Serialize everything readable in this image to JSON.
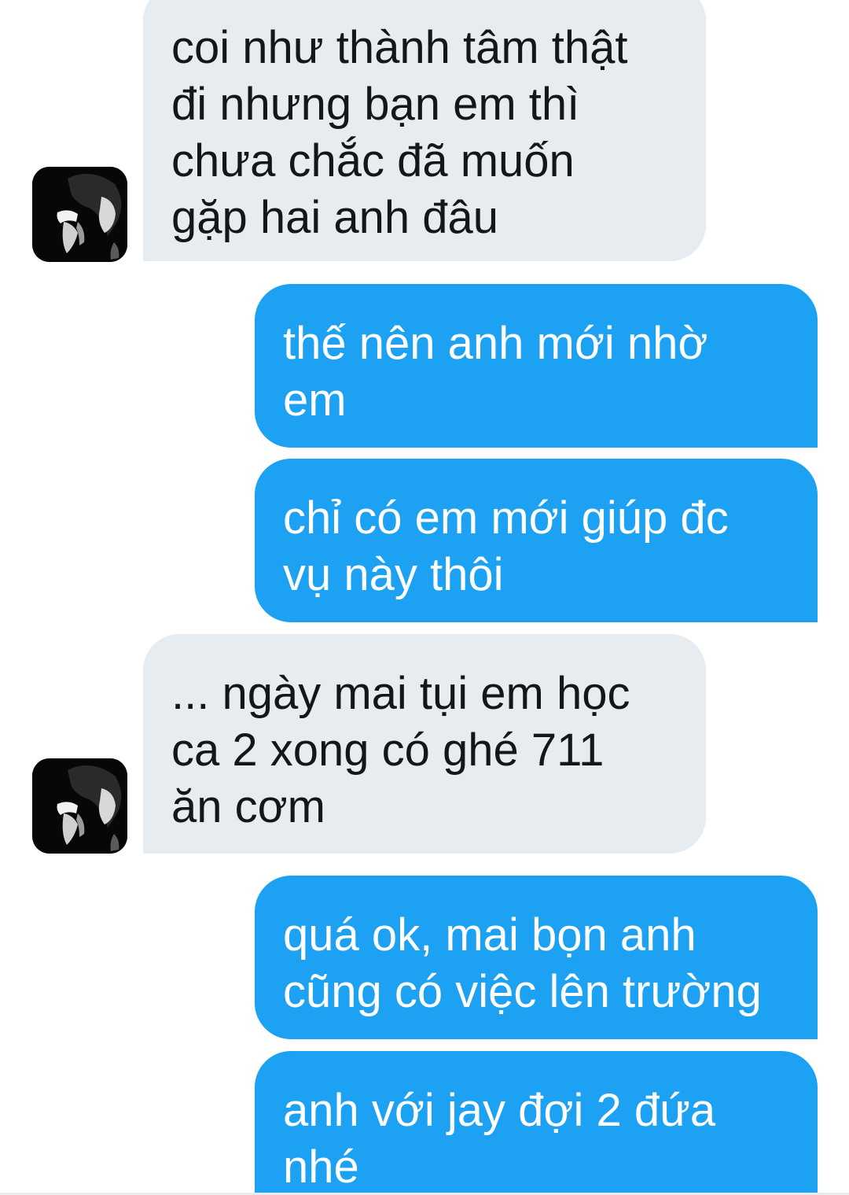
{
  "conversation": {
    "messages": [
      {
        "sender": "contact",
        "text": "coi như thành tâm thật\nđi nhưng bạn em thì\nchưa chắc đã muốn\ngặp hai anh đâu"
      },
      {
        "sender": "me",
        "text": "thế nên anh mới nhờ\nem"
      },
      {
        "sender": "me",
        "text": "chỉ có em mới giúp đc\nvụ này thôi"
      },
      {
        "sender": "contact",
        "text": "... ngày mai tụi em học\nca 2 xong có ghé 711\năn cơm"
      },
      {
        "sender": "me",
        "text": "quá ok, mai bọn anh\ncũng có việc lên trường"
      },
      {
        "sender": "me",
        "text": "anh với jay đợi 2 đứa\nnhé"
      }
    ]
  },
  "colors": {
    "incoming_bubble": "#e6ecf0",
    "incoming_text": "#14171a",
    "outgoing_bubble": "#1da1f2",
    "outgoing_text": "#ffffff"
  },
  "icons": {
    "contact_avatar": "avatar-icon"
  }
}
